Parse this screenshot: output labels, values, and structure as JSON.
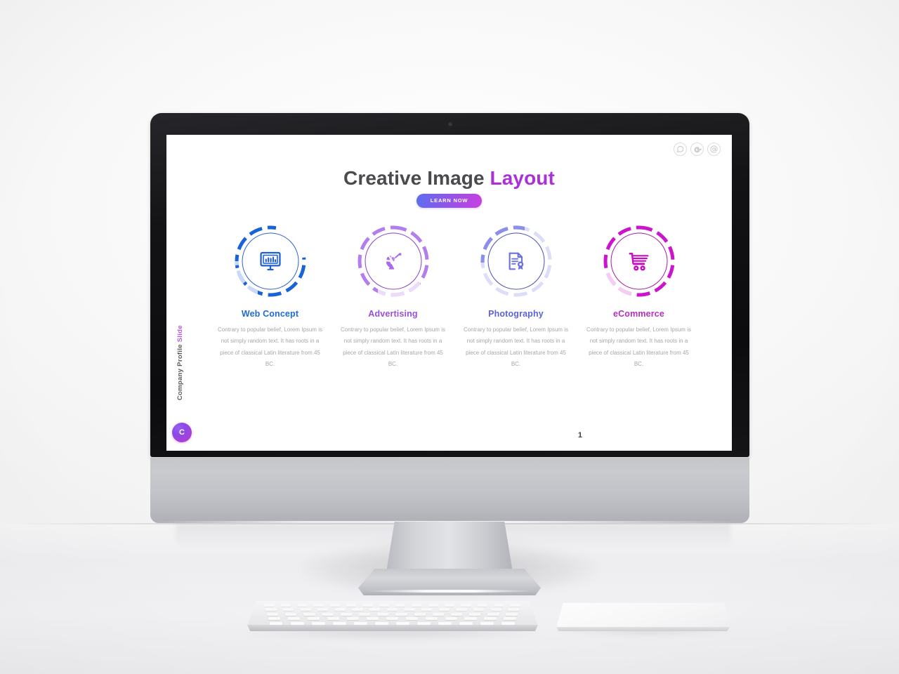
{
  "scene": {
    "device": "desktop-monitor-mockup",
    "page_number": "1"
  },
  "slide": {
    "title_main": "Creative Image ",
    "title_accent": "Layout",
    "cta_label": "LEARN NOW",
    "vertical_label_main": "Company Profile ",
    "vertical_label_accent": "Slide",
    "corner_badge_letter": "C",
    "page_number": "1",
    "social_icons": [
      {
        "name": "whatsapp-icon",
        "glyph": "whatsapp"
      },
      {
        "name": "google-plus-icon",
        "glyph": "google-plus"
      },
      {
        "name": "at-email-icon",
        "glyph": "at"
      }
    ],
    "features": [
      {
        "title": "Web Concept",
        "body": "Contrary to popular belief, Lorem Ipsum is not simply random text. It has roots in a piece of classical Latin literature from 45 BC.",
        "color": "#1a62d8",
        "ring_color": "#1a62d8",
        "ring_fade": "#c9d9f7",
        "icon_name": "monitor-chart-icon",
        "title_color": "#1f6ad4"
      },
      {
        "title": "Advertising",
        "body": "Contrary to popular belief, Lorem Ipsum is not simply random text. It has roots in a piece of classical Latin literature from 45 BC.",
        "color": "#a96ce8",
        "ring_color": "#b47ded",
        "ring_fade": "#ecdcfa",
        "icon_name": "satellite-dish-icon",
        "title_color": "#9b4fd6"
      },
      {
        "title": "Photography",
        "body": "Contrary to popular belief, Lorem Ipsum is not simply random text. It has roots in a piece of classical Latin literature from 45 BC.",
        "color": "#6b72de",
        "ring_color": "#8a90e8",
        "ring_fade": "#dcdef8",
        "icon_name": "certificate-award-icon",
        "title_color": "#5c63d4"
      },
      {
        "title": "eCommerce",
        "body": "Contrary to popular belief, Lorem Ipsum is not simply random text. It has roots in a piece of classical Latin literature from 45 BC.",
        "color": "#c90ac9",
        "ring_color": "#cc14cc",
        "ring_fade": "#f3cdf3",
        "icon_name": "shopping-cart-icon",
        "title_color": "#b82ec0"
      }
    ]
  },
  "colors": {
    "accent_purple": "#aa31d8",
    "cta_gradient_start": "#5b6ff0",
    "cta_gradient_end": "#c93fe0",
    "body_text": "#a7a7ad",
    "title_text": "#4a4a4f"
  }
}
